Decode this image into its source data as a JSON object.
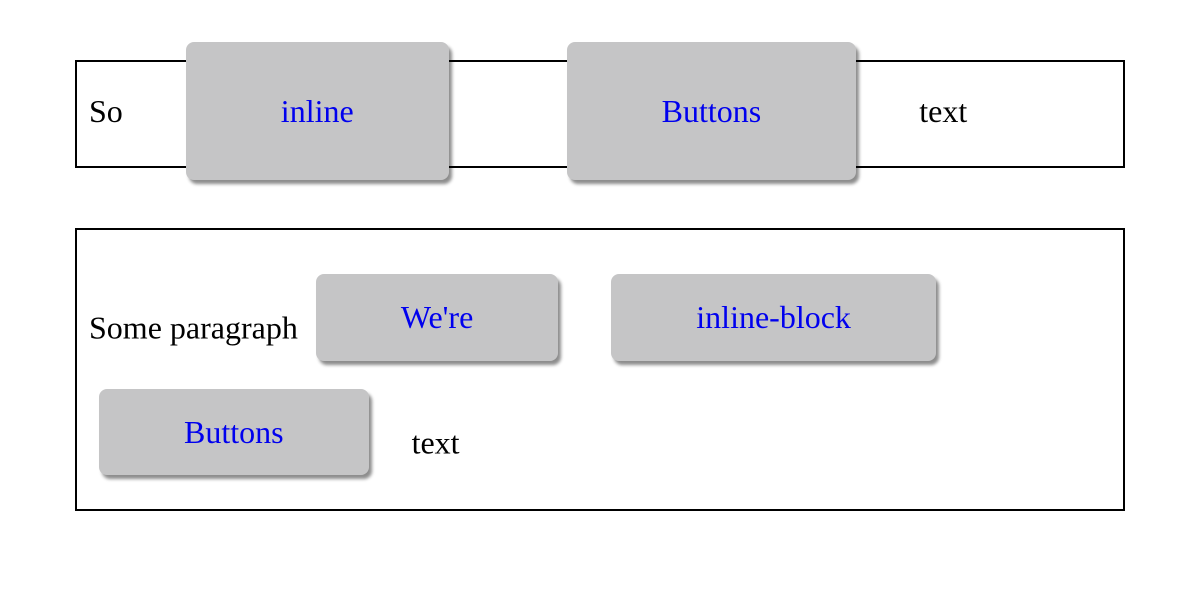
{
  "row1": {
    "prefix": "So",
    "btn1": "inline",
    "btn2": "Buttons",
    "suffix": "text"
  },
  "row2": {
    "prefix": "Some paragraph",
    "btn1": "We're",
    "btn2": "inline-block",
    "btn3": "Buttons",
    "suffix": "text"
  }
}
